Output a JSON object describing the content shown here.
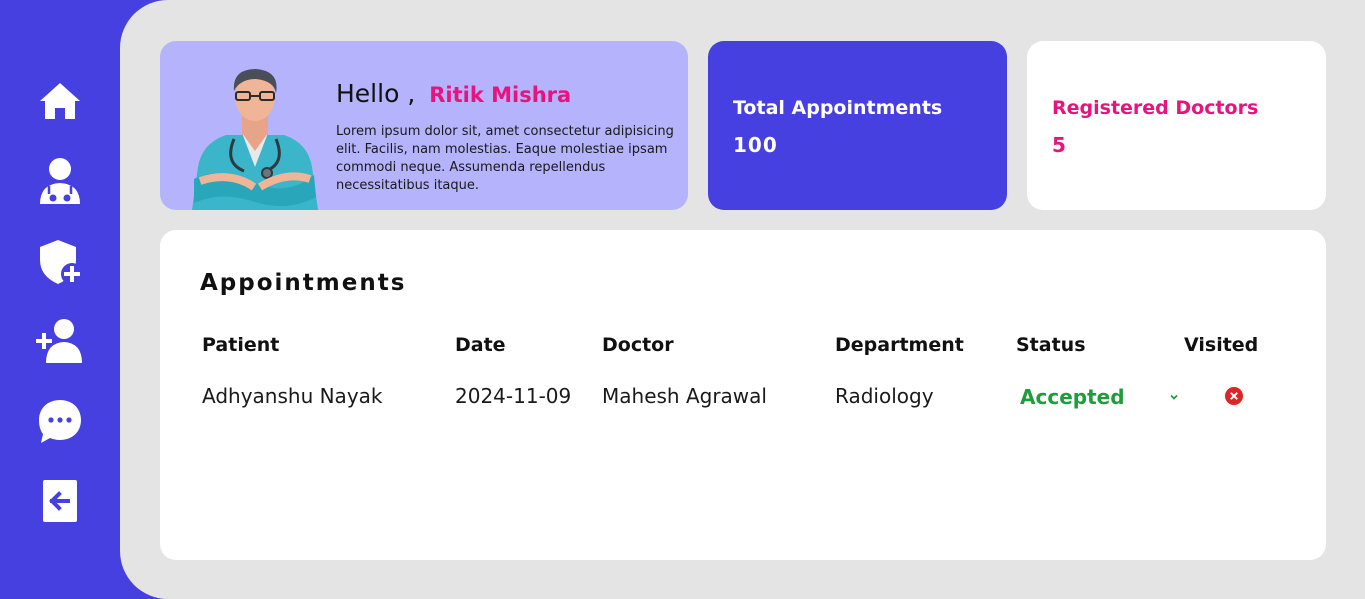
{
  "sidebar": {
    "items": [
      {
        "icon": "home-icon"
      },
      {
        "icon": "doctor-icon"
      },
      {
        "icon": "add-admin-shield-icon"
      },
      {
        "icon": "add-user-icon"
      },
      {
        "icon": "messages-icon"
      },
      {
        "icon": "logout-icon"
      }
    ]
  },
  "welcome": {
    "greeting": "Hello ,",
    "name": "Ritik Mishra",
    "description": "Lorem ipsum dolor sit, amet consectetur adipisicing elit. Facilis, nam molestias. Eaque molestiae ipsam commodi neque. Assumenda repellendus necessitatibus itaque."
  },
  "stats": {
    "appointments": {
      "label": "Total Appointments",
      "value": "100"
    },
    "doctors": {
      "label": "Registered Doctors",
      "value": "5"
    }
  },
  "appointments": {
    "title": "Appointments",
    "columns": {
      "patient": "Patient",
      "date": "Date",
      "doctor": "Doctor",
      "department": "Department",
      "status": "Status",
      "visited": "Visited"
    },
    "rows": [
      {
        "patient": "Adhyanshu Nayak",
        "date": "2024-11-09",
        "doctor": "Mahesh Agrawal",
        "department": "Radiology",
        "status": "Accepted",
        "visited_icon": "not-visited-x-icon"
      }
    ]
  },
  "colors": {
    "primary": "#4540df",
    "accent": "#e9137e",
    "status_accepted": "#1f9d3c",
    "not_visited": "#dc2626"
  }
}
